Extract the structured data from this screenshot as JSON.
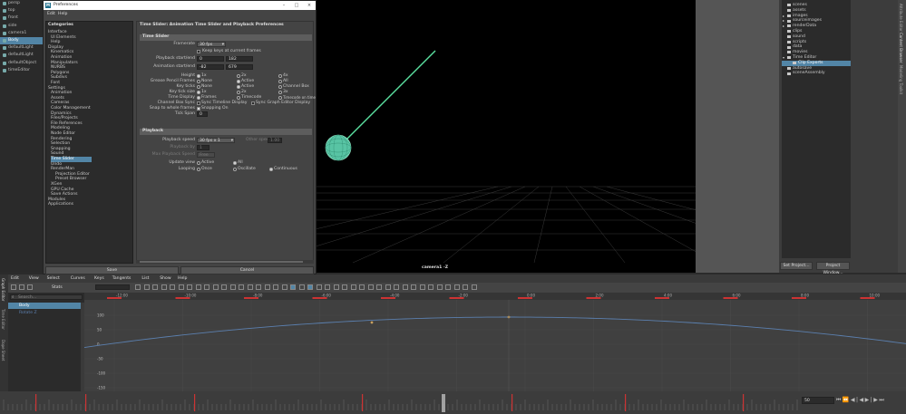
{
  "outliner": {
    "items": [
      {
        "label": "persp",
        "selected": false
      },
      {
        "label": "top",
        "selected": false
      },
      {
        "label": "front",
        "selected": false
      },
      {
        "label": "side",
        "selected": false
      },
      {
        "label": "camera1",
        "selected": false
      },
      {
        "label": "Body",
        "selected": true
      },
      {
        "label": "defaultLight",
        "selected": false
      },
      {
        "label": "defaultLight",
        "selected": false
      },
      {
        "label": "defaultObject",
        "selected": false
      },
      {
        "label": "timeEditor",
        "selected": false
      }
    ]
  },
  "prefs": {
    "title": "Preferences",
    "menu": [
      "Edit",
      "Help"
    ],
    "categories_header": "Categories",
    "categories": [
      {
        "label": "Interface",
        "indent": 0
      },
      {
        "label": "UI Elements",
        "indent": 1
      },
      {
        "label": "Help",
        "indent": 1
      },
      {
        "label": "Display",
        "indent": 0
      },
      {
        "label": "Kinematics",
        "indent": 1
      },
      {
        "label": "Animation",
        "indent": 1
      },
      {
        "label": "Manipulators",
        "indent": 1
      },
      {
        "label": "NURBS",
        "indent": 1
      },
      {
        "label": "Polygons",
        "indent": 1
      },
      {
        "label": "Subdivs",
        "indent": 1
      },
      {
        "label": "Font",
        "indent": 1
      },
      {
        "label": "Settings",
        "indent": 0
      },
      {
        "label": "Animation",
        "indent": 1
      },
      {
        "label": "Assets",
        "indent": 1
      },
      {
        "label": "Cameras",
        "indent": 1
      },
      {
        "label": "Color Management",
        "indent": 1
      },
      {
        "label": "Dynamics",
        "indent": 1
      },
      {
        "label": "Files/Projects",
        "indent": 1
      },
      {
        "label": "File References",
        "indent": 1
      },
      {
        "label": "Modeling",
        "indent": 1
      },
      {
        "label": "Node Editor",
        "indent": 1
      },
      {
        "label": "Rendering",
        "indent": 1
      },
      {
        "label": "Selection",
        "indent": 1
      },
      {
        "label": "Snapping",
        "indent": 1
      },
      {
        "label": "Sound",
        "indent": 1
      },
      {
        "label": "Time Slider",
        "indent": 1,
        "selected": true
      },
      {
        "label": "Undo",
        "indent": 1
      },
      {
        "label": "RenderMan",
        "indent": 1
      },
      {
        "label": "Projection Editor",
        "indent": 2
      },
      {
        "label": "Preset Browser",
        "indent": 2
      },
      {
        "label": "XGen",
        "indent": 1
      },
      {
        "label": "GPU Cache",
        "indent": 1
      },
      {
        "label": "Save Actions",
        "indent": 1
      },
      {
        "label": "Modules",
        "indent": 0
      },
      {
        "label": "Applications",
        "indent": 0
      }
    ],
    "panel_title": "Time Slider: Animation Time Slider and Playback Preferences",
    "time_slider": {
      "section": "Time Slider",
      "framerate_label": "Framerate",
      "framerate_value": "30 fps",
      "keep_keys_label": "Keep keys at current frames",
      "playback_range_label": "Playback start/end",
      "playback_start": "0",
      "playback_end": "182",
      "anim_range_label": "Animation start/end",
      "anim_start": "-82",
      "anim_end": "679",
      "height_label": "Height",
      "height_opts": [
        "1x",
        "2x",
        "4x"
      ],
      "grease_label": "Grease Pencil Frames",
      "grease_opts": [
        "None",
        "Active",
        "All"
      ],
      "key_ticks_label": "Key ticks",
      "key_ticks_opts": [
        "None",
        "Active",
        "Channel Box",
        "Smart"
      ],
      "tick_size_label": "Key tick size",
      "tick_size_opts": [
        "1x",
        "2x",
        "3x",
        "4x"
      ],
      "time_display_label": "Time Display",
      "time_display_opts": [
        "Frames",
        "Timecode",
        "Timecode on time marker and play range"
      ],
      "channel_sync_label": "Channel Box Sync",
      "channel_sync_opt": "Sync Timeline Display",
      "sync_graph_opt": "Sync Graph Editor Display",
      "snap_label": "Snap to whole frames",
      "snap_opt": "Snapping On",
      "tick_span_label": "Tick Span",
      "tick_span_value": "0"
    },
    "playback": {
      "section": "Playback",
      "speed_label": "Playback speed",
      "speed_value": "30 fps x 1",
      "other_speed_label": "Other speed",
      "other_speed_value": "1.00",
      "playback_by_label": "Playback by",
      "playback_by_value": "1",
      "max_speed_label": "Max Playback Speed",
      "max_speed_value": "Free",
      "update_view_label": "Update view",
      "update_view_opts": [
        "Active",
        "All"
      ],
      "looping_label": "Looping",
      "looping_opts": [
        "Once",
        "Oscillate",
        "Continuous"
      ]
    },
    "save_label": "Save",
    "cancel_label": "Cancel"
  },
  "viewport": {
    "camera_label": "camera1 -Z"
  },
  "file_tree": {
    "items": [
      {
        "label": "scenes",
        "arrow": ""
      },
      {
        "label": "assets",
        "arrow": ""
      },
      {
        "label": "images",
        "arrow": "▸"
      },
      {
        "label": "sourceimages",
        "arrow": "▸"
      },
      {
        "label": "renderData",
        "arrow": "▸"
      },
      {
        "label": "clips",
        "arrow": ""
      },
      {
        "label": "sound",
        "arrow": ""
      },
      {
        "label": "scripts",
        "arrow": ""
      },
      {
        "label": "data",
        "arrow": ""
      },
      {
        "label": "movies",
        "arrow": ""
      },
      {
        "label": "Time Editor",
        "arrow": "▾"
      },
      {
        "label": "Clip Exports",
        "arrow": "",
        "selected": true,
        "indent": true
      },
      {
        "label": "autosave",
        "arrow": ""
      },
      {
        "label": "sceneAssembly",
        "arrow": ""
      }
    ],
    "set_project_label": "Set Project...",
    "project_window_label": "Project Window..."
  },
  "side_tabs": [
    "Attribute Editor",
    "Content Browser",
    "Modeling Toolkit"
  ],
  "graph_editor": {
    "menu": [
      "Edit",
      "View",
      "Select",
      "Curves",
      "Keys",
      "Tangents",
      "List",
      "Show",
      "Help"
    ],
    "stats_label": "Stats",
    "search_placeholder": "Search...",
    "tree": [
      {
        "label": "Body",
        "selected": true
      },
      {
        "label": "Rotate Z",
        "selected": false
      }
    ],
    "vertical_tabs": [
      "Graph Editor",
      "Time Editor",
      "Dope Sheet"
    ],
    "top_ticks": [
      "-12:00",
      "-10:00",
      "-8:00",
      "-6:00",
      "-4:00",
      "-2:00",
      "0:00",
      "2:00",
      "4:00",
      "6:00",
      "8:00",
      "10:00",
      "12:00"
    ],
    "y_labels": [
      "100",
      "50",
      "0",
      "-50",
      "-100",
      "-150"
    ],
    "curve_color": "#5b7fae",
    "key_color": "#c8a060"
  },
  "timeline": {
    "current_frame": "50",
    "accent": "#cc3333"
  }
}
